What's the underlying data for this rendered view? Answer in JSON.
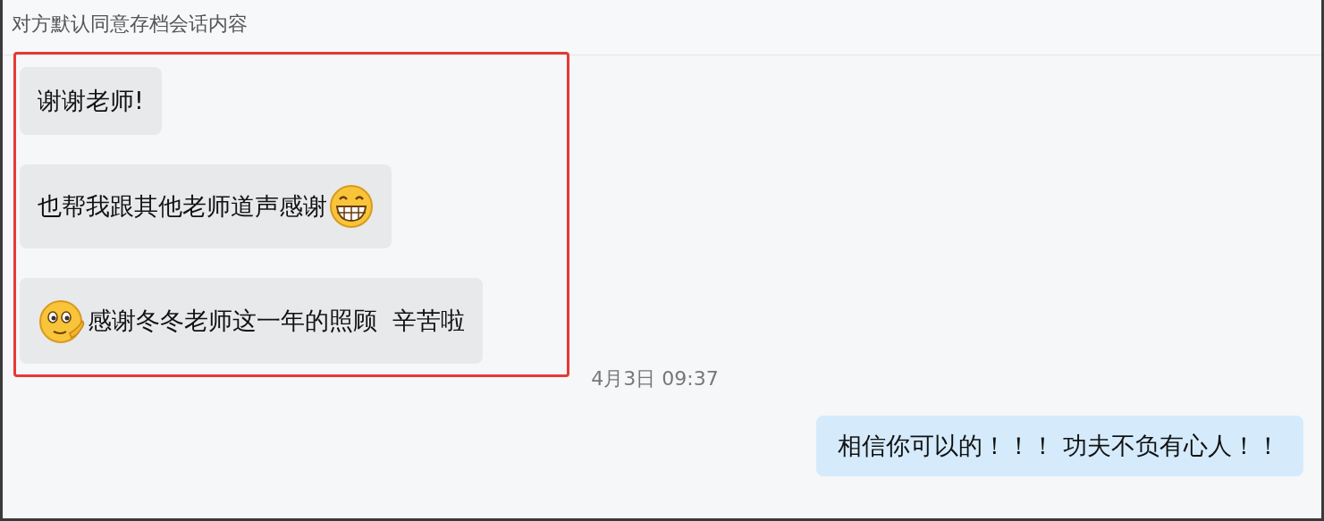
{
  "header": {
    "title": "对方默认同意存档会话内容"
  },
  "highlighted_messages": [
    {
      "kind": "received",
      "parts": [
        {
          "kind": "text",
          "text": "谢谢老师!"
        }
      ]
    },
    {
      "kind": "received",
      "parts": [
        {
          "kind": "text",
          "text": "也帮我跟其他老师道声感谢"
        },
        {
          "kind": "grin-emoji"
        }
      ]
    },
    {
      "kind": "received",
      "parts": [
        {
          "kind": "salute-emoji"
        },
        {
          "kind": "text",
          "text": "感谢冬冬老师这一年的照顾  辛苦啦"
        }
      ]
    }
  ],
  "timestamp": "4月3日 09:37",
  "messages": [
    {
      "kind": "sent",
      "parts": [
        {
          "kind": "text",
          "text": "相信你可以的！！！ 功夫不负有心人！！"
        }
      ]
    }
  ]
}
